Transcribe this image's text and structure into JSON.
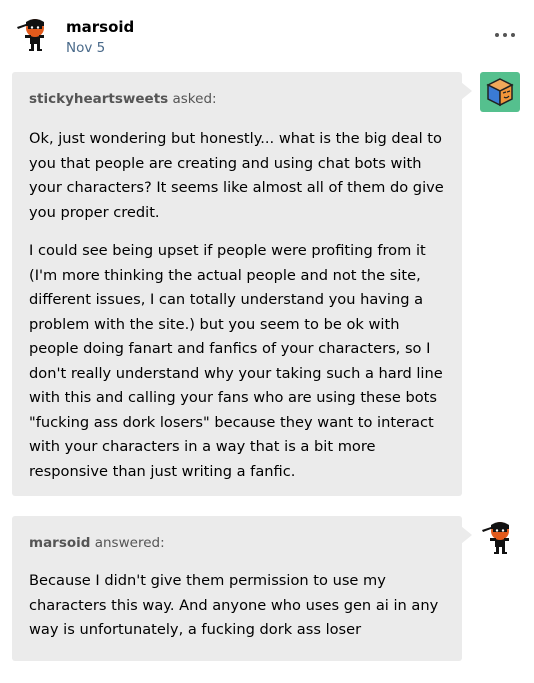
{
  "post": {
    "author": "marsoid",
    "date": "Nov 5"
  },
  "ask": {
    "asker": "stickyheartsweets",
    "asked_label": " asked:",
    "paragraphs": [
      "Ok, just wondering but honestly... what is the big deal to you that people are creating and using chat bots with your characters? It seems like almost all of them do give you proper credit.",
      "I could see being upset if people were profiting from it (I'm more thinking the actual people and not the site, different issues, I can totally understand you having a problem with the site.) but you seem to be ok with people doing fanart and fanfics of your characters, so I don't really understand why your taking such a hard line with this and calling your fans who are using these bots \"fucking ass dork losers\" because they want to interact with your characters in a way that is a bit more responsive than just writing a fanfic."
    ]
  },
  "answer": {
    "answerer": "marsoid",
    "answered_label": " answered:",
    "text": "Because I didn't give them permission to use my characters this way. And anyone who uses gen ai in any way is unfortunately, a fucking dork ass loser"
  },
  "colors": {
    "bubble": "#ebebeb",
    "date": "#4a6a8a",
    "asker_avatar_bg": "#55c08e",
    "character_orange": "#e25a1c"
  },
  "icons": {
    "author_avatar": "masked-character-icon",
    "more": "ellipsis-icon",
    "asker_avatar": "cube-icon"
  }
}
